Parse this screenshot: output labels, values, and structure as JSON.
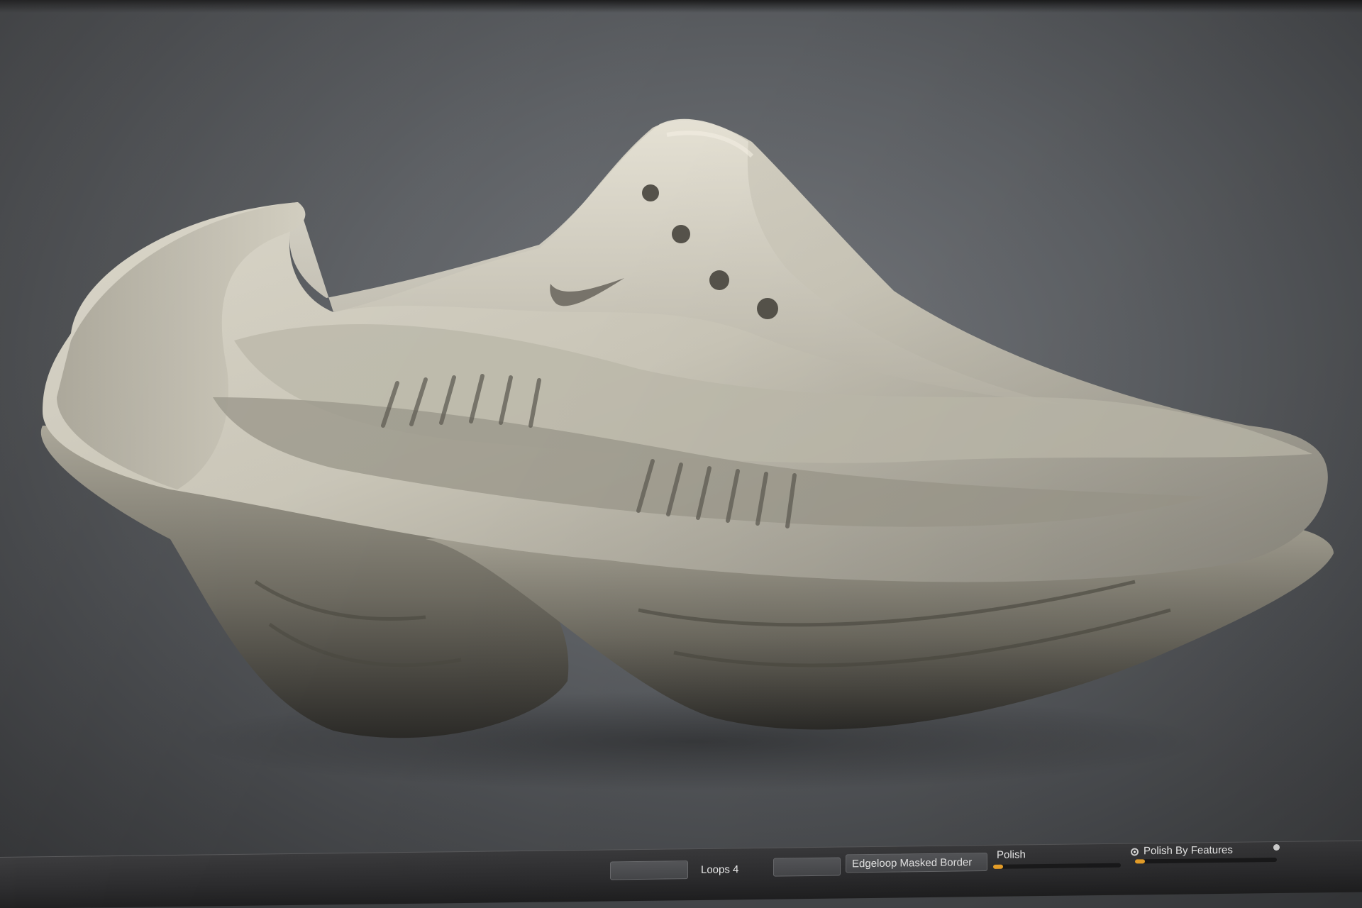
{
  "viewport": {
    "subject": "3D sculpted sneaker model",
    "logo": "swoosh"
  },
  "toolbar": {
    "loops_label": "Loops 4",
    "edgeloop_button": "Edgeloop Masked Border",
    "polish_label": "Polish",
    "polish_by_features_label": "Polish By Features"
  },
  "colors": {
    "background": "#5d6064",
    "model": "#cfcbbd",
    "accent": "#f0a52a"
  }
}
